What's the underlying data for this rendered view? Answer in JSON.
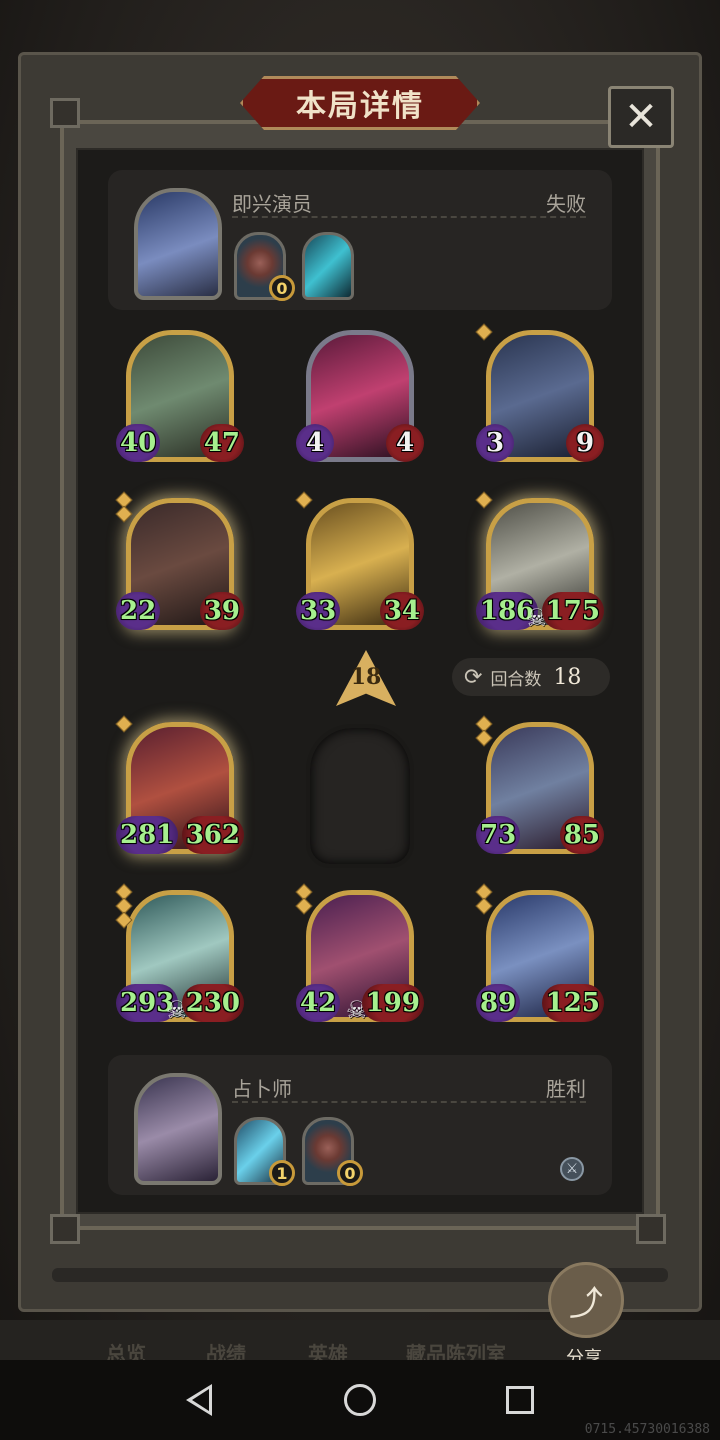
{
  "title": "本局详情",
  "close_icon": "close-icon",
  "opponent": {
    "name": "即兴演员",
    "result": "失败",
    "relics": [
      {
        "icon": "gear-relic-icon",
        "count": "0"
      },
      {
        "icon": "crystal-relic-icon"
      }
    ]
  },
  "player": {
    "name": "占卜师",
    "result": "胜利",
    "relics": [
      {
        "icon": "blue-card-relic-icon",
        "count": "1"
      },
      {
        "icon": "gear-relic-icon",
        "count": "0"
      }
    ]
  },
  "enemy_units": [
    {
      "attack": "40",
      "health": "47"
    },
    {
      "attack": "4",
      "health": "4"
    },
    {
      "attack": "3",
      "health": "9"
    },
    {
      "attack": "22",
      "health": "39"
    },
    {
      "attack": "33",
      "health": "34"
    },
    {
      "attack": "186",
      "health": "175"
    }
  ],
  "turn_marker": "18",
  "rounds": {
    "label": "回合数",
    "value": "18"
  },
  "player_units": [
    {
      "attack": "281",
      "health": "362"
    },
    {
      "attack": "73",
      "health": "85"
    },
    {
      "attack": "293",
      "health": "230"
    },
    {
      "attack": "42",
      "health": "199"
    },
    {
      "attack": "89",
      "health": "125"
    }
  ],
  "tabs": [
    "总览",
    "战绩",
    "英雄",
    "藏品陈列室"
  ],
  "share_label": "分享",
  "build_id": "0715.45730016388"
}
